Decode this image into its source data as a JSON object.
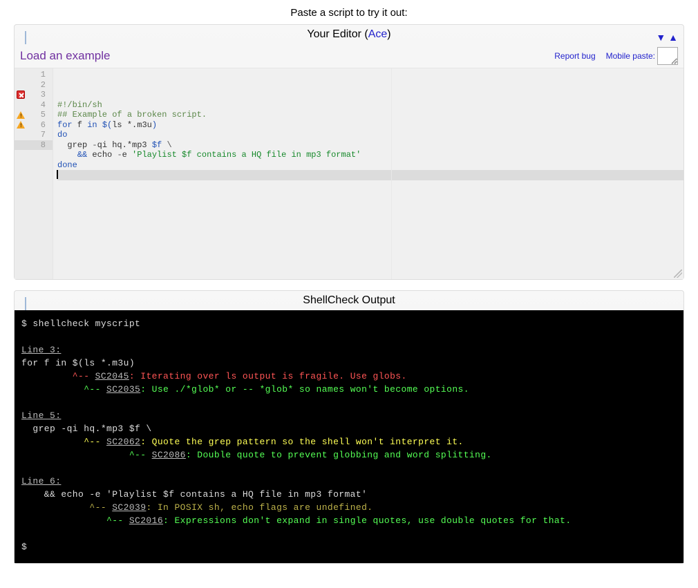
{
  "prompt": "Paste a script to try it out:",
  "editor_panel": {
    "title_prefix": "Your Editor (",
    "title_link": "Ace",
    "title_suffix": ")",
    "load_example": "Load an example",
    "report_bug": "Report bug",
    "mobile_paste": "Mobile paste:"
  },
  "editor": {
    "lines": [
      1,
      2,
      3,
      4,
      5,
      6,
      7,
      8
    ],
    "markers": {
      "3": "error",
      "5": "warning",
      "6": "warning"
    },
    "active_line": 8,
    "code": [
      {
        "n": 1,
        "seg": [
          {
            "c": "tok-comment",
            "t": "#!/bin/sh"
          }
        ]
      },
      {
        "n": 2,
        "seg": [
          {
            "c": "tok-comment",
            "t": "## Example of a broken script."
          }
        ]
      },
      {
        "n": 3,
        "seg": [
          {
            "c": "tok-kw",
            "t": "for"
          },
          {
            "t": " f "
          },
          {
            "c": "tok-kw",
            "t": "in"
          },
          {
            "t": " "
          },
          {
            "c": "tok-var",
            "t": "$("
          },
          {
            "t": "ls *.m3u"
          },
          {
            "c": "tok-var",
            "t": ")"
          }
        ]
      },
      {
        "n": 4,
        "seg": [
          {
            "c": "tok-kw",
            "t": "do"
          }
        ]
      },
      {
        "n": 5,
        "seg": [
          {
            "t": "  grep "
          },
          {
            "c": "tok-punc",
            "t": "-"
          },
          {
            "t": "qi hq.*mp3 "
          },
          {
            "c": "tok-var",
            "t": "$f"
          },
          {
            "t": " "
          },
          {
            "c": "tok-punc",
            "t": "\\"
          }
        ]
      },
      {
        "n": 6,
        "seg": [
          {
            "t": "    "
          },
          {
            "c": "tok-kw",
            "t": "&&"
          },
          {
            "t": " echo "
          },
          {
            "c": "tok-punc",
            "t": "-"
          },
          {
            "t": "e "
          },
          {
            "c": "tok-str",
            "t": "'Playlist $f contains a HQ file in mp3 format'"
          }
        ]
      },
      {
        "n": 7,
        "seg": [
          {
            "c": "tok-kw",
            "t": "done"
          }
        ]
      },
      {
        "n": 8,
        "seg": []
      }
    ]
  },
  "output_panel": {
    "title": "ShellCheck Output"
  },
  "output": {
    "cmd": "$ shellcheck myscript",
    "blocks": [
      {
        "line_label": "Line 3:",
        "src": "for f in $(ls *.m3u)",
        "msgs": [
          {
            "indent": "         ",
            "sev": "red",
            "code": "SC2045",
            "text": ": Iterating over ls output is fragile. Use globs."
          },
          {
            "indent": "           ",
            "sev": "green",
            "code": "SC2035",
            "text": ": Use ./*glob* or -- *glob* so names won't become options."
          }
        ]
      },
      {
        "line_label": "Line 5:",
        "src": "  grep -qi hq.*mp3 $f \\",
        "msgs": [
          {
            "indent": "           ",
            "sev": "yellow",
            "code": "SC2062",
            "text": ": Quote the grep pattern so the shell won't interpret it."
          },
          {
            "indent": "                   ",
            "sev": "green",
            "code": "SC2086",
            "text": ": Double quote to prevent globbing and word splitting."
          }
        ]
      },
      {
        "line_label": "Line 6:",
        "src": "    && echo -e 'Playlist $f contains a HQ file in mp3 format'",
        "msgs": [
          {
            "indent": "            ",
            "sev": "yellow-dim",
            "code": "SC2039",
            "text": ": In POSIX sh, echo flags are undefined."
          },
          {
            "indent": "               ",
            "sev": "green",
            "code": "SC2016",
            "text": ": Expressions don't expand in single quotes, use double quotes for that."
          }
        ]
      }
    ],
    "end_prompt": "$"
  }
}
